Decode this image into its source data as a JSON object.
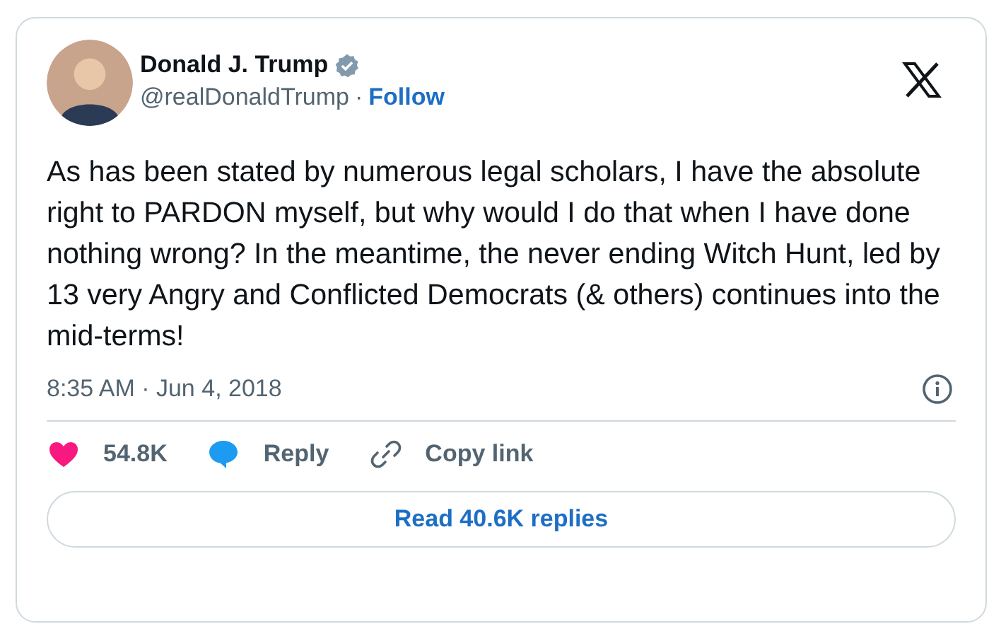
{
  "author": {
    "name": "Donald J. Trump",
    "verified": true,
    "handle": "@realDonaldTrump",
    "separator": "·",
    "follow_label": "Follow"
  },
  "tweet": {
    "text": "As has been stated by numerous legal scholars, I have the absolute right to PARDON myself, but why would I do that when I have done nothing wrong? In the meantime, the never ending Witch Hunt, led by 13 very Angry and Conflicted Democrats (& others) continues into the mid-terms!",
    "timestamp": "8:35 AM · Jun 4, 2018"
  },
  "actions": [
    {
      "kind": "like",
      "label": "54.8K"
    },
    {
      "kind": "reply",
      "label": "Reply"
    },
    {
      "kind": "copy",
      "label": "Copy link"
    }
  ],
  "read_replies_label": "Read 40.6K replies"
}
